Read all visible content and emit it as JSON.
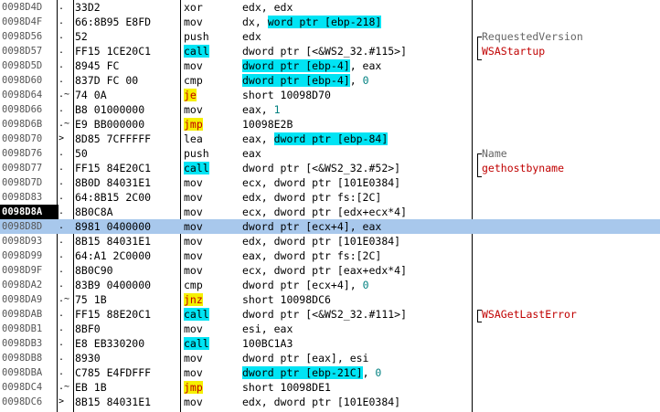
{
  "colors": {
    "selected_row": "#a8c8ec",
    "call_highlight": "#00e4f4",
    "jump_highlight": "#f5f000",
    "comment_function": "#c00000",
    "comment_label": "#666666"
  },
  "rows": [
    {
      "addr": "0098D4D",
      "mark": ".",
      "hex": "33D2",
      "mn": "xor",
      "op": [
        {
          "t": "edx, edx"
        }
      ],
      "cm": ""
    },
    {
      "addr": "0098D4F",
      "mark": ".",
      "hex": "66:8B95 E8FD",
      "mn": "mov",
      "op": [
        {
          "t": "dx, "
        },
        {
          "t": "word ptr [ebp-218]",
          "c": "hl-cyan"
        }
      ],
      "cm": ""
    },
    {
      "addr": "0098D56",
      "mark": ".",
      "hex": "52",
      "mn": "push",
      "op": [
        {
          "t": "edx"
        }
      ],
      "cm": "RequestedVersion",
      "cmc": "cm-label"
    },
    {
      "addr": "0098D57",
      "mark": ".",
      "hex": "FF15 1CE20C1",
      "mn": "call",
      "op": [
        {
          "t": "dword ptr [<&WS2_32.#115>]"
        }
      ],
      "cm": "WSAStartup",
      "cmc": "cm-func"
    },
    {
      "addr": "0098D5D",
      "mark": ".",
      "hex": "8945 FC",
      "mn": "mov",
      "op": [
        {
          "t": "dword ptr [ebp-4]",
          "c": "hl-cyan"
        },
        {
          "t": ", eax"
        }
      ],
      "cm": ""
    },
    {
      "addr": "0098D60",
      "mark": ".",
      "hex": "837D FC 00",
      "mn": "cmp",
      "op": [
        {
          "t": "dword ptr [ebp-4]",
          "c": "hl-cyan"
        },
        {
          "t": ", "
        },
        {
          "t": "0",
          "c": "num"
        }
      ],
      "cm": ""
    },
    {
      "addr": "0098D64",
      "mark": ".~",
      "hex": "74 0A",
      "mn": "je",
      "op": [
        {
          "t": "short 10098D70"
        }
      ],
      "cm": ""
    },
    {
      "addr": "0098D66",
      "mark": ".",
      "hex": "B8 01000000",
      "mn": "mov",
      "op": [
        {
          "t": "eax, "
        },
        {
          "t": "1",
          "c": "num"
        }
      ],
      "cm": ""
    },
    {
      "addr": "0098D6B",
      "mark": ".~",
      "hex": "E9 BB000000",
      "mn": "jmp",
      "op": [
        {
          "t": "10098E2B"
        }
      ],
      "cm": ""
    },
    {
      "addr": "0098D70",
      "mark": ">",
      "hex": "8D85 7CFFFFF",
      "mn": "lea",
      "op": [
        {
          "t": "eax, "
        },
        {
          "t": "dword ptr [ebp-84]",
          "c": "hl-cyan"
        }
      ],
      "cm": ""
    },
    {
      "addr": "0098D76",
      "mark": ".",
      "hex": "50",
      "mn": "push",
      "op": [
        {
          "t": "eax"
        }
      ],
      "cm": "Name",
      "cmc": "cm-label"
    },
    {
      "addr": "0098D77",
      "mark": ".",
      "hex": "FF15 84E20C1",
      "mn": "call",
      "op": [
        {
          "t": "dword ptr [<&WS2_32.#52>]"
        }
      ],
      "cm": "gethostbyname",
      "cmc": "cm-func"
    },
    {
      "addr": "0098D7D",
      "mark": ".",
      "hex": "8B0D 84031E1",
      "mn": "mov",
      "op": [
        {
          "t": "ecx, dword ptr [101E0384]"
        }
      ],
      "cm": ""
    },
    {
      "addr": "0098D83",
      "mark": ".",
      "hex": "64:8B15 2C00",
      "mn": "mov",
      "op": [
        {
          "t": "edx, dword ptr fs:[2C]"
        }
      ],
      "cm": ""
    },
    {
      "addr": "0098D8A",
      "mark": ".",
      "hex": "8B0C8A",
      "mn": "mov",
      "op": [
        {
          "t": "ecx, dword ptr [edx+ecx*4]"
        }
      ],
      "cm": ""
    },
    {
      "addr": "0098D8D",
      "mark": ".",
      "hex": "8981 0400000",
      "mn": "mov",
      "op": [
        {
          "t": "dword ptr [ecx+4], eax"
        }
      ],
      "cm": ""
    },
    {
      "addr": "0098D93",
      "mark": ".",
      "hex": "8B15 84031E1",
      "mn": "mov",
      "op": [
        {
          "t": "edx, dword ptr [101E0384]"
        }
      ],
      "cm": ""
    },
    {
      "addr": "0098D99",
      "mark": ".",
      "hex": "64:A1 2C0000",
      "mn": "mov",
      "op": [
        {
          "t": "eax, dword ptr fs:[2C]"
        }
      ],
      "cm": ""
    },
    {
      "addr": "0098D9F",
      "mark": ".",
      "hex": "8B0C90",
      "mn": "mov",
      "op": [
        {
          "t": "ecx, dword ptr [eax+edx*4]"
        }
      ],
      "cm": ""
    },
    {
      "addr": "0098DA2",
      "mark": ".",
      "hex": "83B9 0400000",
      "mn": "cmp",
      "op": [
        {
          "t": "dword ptr [ecx+4], "
        },
        {
          "t": "0",
          "c": "num"
        }
      ],
      "cm": ""
    },
    {
      "addr": "0098DA9",
      "mark": ".~",
      "hex": "75 1B",
      "mn": "jnz",
      "op": [
        {
          "t": "short 10098DC6"
        }
      ],
      "cm": ""
    },
    {
      "addr": "0098DAB",
      "mark": ".",
      "hex": "FF15 88E20C1",
      "mn": "call",
      "op": [
        {
          "t": "dword ptr [<&WS2_32.#111>]"
        }
      ],
      "cm": "WSAGetLastError",
      "cmc": "cm-func"
    },
    {
      "addr": "0098DB1",
      "mark": ".",
      "hex": "8BF0",
      "mn": "mov",
      "op": [
        {
          "t": "esi, eax"
        }
      ],
      "cm": ""
    },
    {
      "addr": "0098DB3",
      "mark": ".",
      "hex": "E8 EB330200",
      "mn": "call",
      "op": [
        {
          "t": "100BC1A3"
        }
      ],
      "cm": ""
    },
    {
      "addr": "0098DB8",
      "mark": ".",
      "hex": "8930",
      "mn": "mov",
      "op": [
        {
          "t": "dword ptr [eax], esi"
        }
      ],
      "cm": ""
    },
    {
      "addr": "0098DBA",
      "mark": ".",
      "hex": "C785 E4FDFFF",
      "mn": "mov",
      "op": [
        {
          "t": "dword ptr [ebp-21C]",
          "c": "hl-cyan"
        },
        {
          "t": ", "
        },
        {
          "t": "0",
          "c": "num"
        }
      ],
      "cm": ""
    },
    {
      "addr": "0098DC4",
      "mark": ".~",
      "hex": "EB 1B",
      "mn": "jmp",
      "op": [
        {
          "t": "short 10098DE1"
        }
      ],
      "cm": ""
    },
    {
      "addr": "0098DC6",
      "mark": ">",
      "hex": "8B15 84031E1",
      "mn": "mov",
      "op": [
        {
          "t": "edx, dword ptr [101E0384]"
        }
      ],
      "cm": ""
    }
  ],
  "current_index": 14,
  "selected_index": 15
}
